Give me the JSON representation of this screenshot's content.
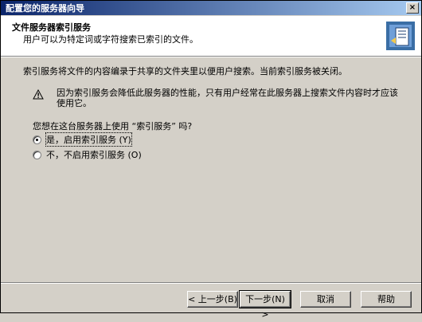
{
  "window": {
    "title": "配置您的服务器向导",
    "close_label": "×"
  },
  "header": {
    "title": "文件服务器索引服务",
    "subtitle": "用户可以为特定词或字符搜索已索引的文件。"
  },
  "body": {
    "info": "索引服务将文件的内容编录于共享的文件夹里以便用户搜索。当前索引服务被关闭。",
    "warning": "因为索引服务会降低此服务器的性能，只有用户经常在此服务器上搜索文件内容时才应该使用它。",
    "question": "您想在这台服务器上使用 “索引服务” 吗?",
    "options": [
      {
        "label": "是，启用索引服务 (Y)",
        "checked": true
      },
      {
        "label": "不，不启用索引服务 (O)",
        "checked": false
      }
    ]
  },
  "buttons": {
    "back": "< 上一步(B)",
    "next": "下一步(N) >",
    "cancel": "取消",
    "help": "帮助"
  }
}
